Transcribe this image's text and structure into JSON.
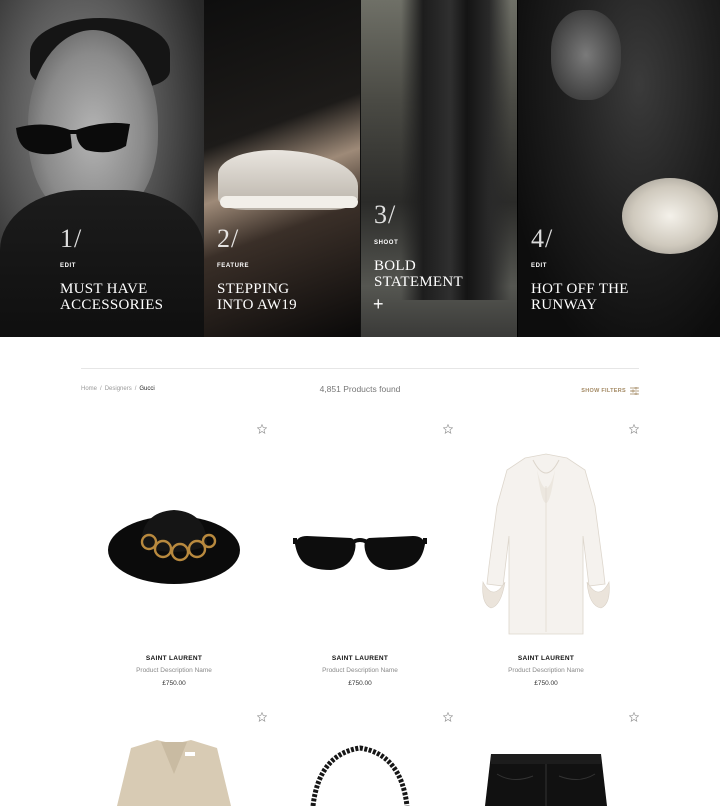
{
  "hero": {
    "tiles": [
      {
        "number": "1/",
        "kicker": "EDIT",
        "title_line1": "MUST HAVE",
        "title_line2": "ACCESSORIES"
      },
      {
        "number": "2/",
        "kicker": "FEATURE",
        "title_line1": "STEPPING",
        "title_line2": "INTO AW19"
      },
      {
        "number": "3/",
        "kicker": "SHOOT",
        "title_line1": "BOLD",
        "title_line2": "STATEMENT",
        "plus": "+"
      },
      {
        "number": "4/",
        "kicker": "EDIT",
        "title_line1": "HOT OFF THE",
        "title_line2": "RUNWAY"
      }
    ]
  },
  "toolbar": {
    "breadcrumb": {
      "home": "Home",
      "designers": "Designers",
      "current": "Gucci",
      "separator": "/"
    },
    "results_count": "4,851 Products found",
    "filters_label": "SHOW FILTERS"
  },
  "products": [
    {
      "brand": "SAINT LAURENT",
      "description": "Product Description Name",
      "price": "£750.00",
      "image": "black-fedora-hat-icon"
    },
    {
      "brand": "SAINT LAURENT",
      "description": "Product Description Name",
      "price": "£750.00",
      "image": "black-sunglasses-icon"
    },
    {
      "brand": "SAINT LAURENT",
      "description": "Product Description Name",
      "price": "£750.00",
      "image": "white-ruffle-blouse-icon"
    },
    {
      "image": "beige-blazer-icon"
    },
    {
      "image": "black-necklace-icon"
    },
    {
      "image": "black-leather-shorts-icon"
    }
  ],
  "colors": {
    "accent": "#a48a64",
    "muted": "#8a8a8a"
  }
}
